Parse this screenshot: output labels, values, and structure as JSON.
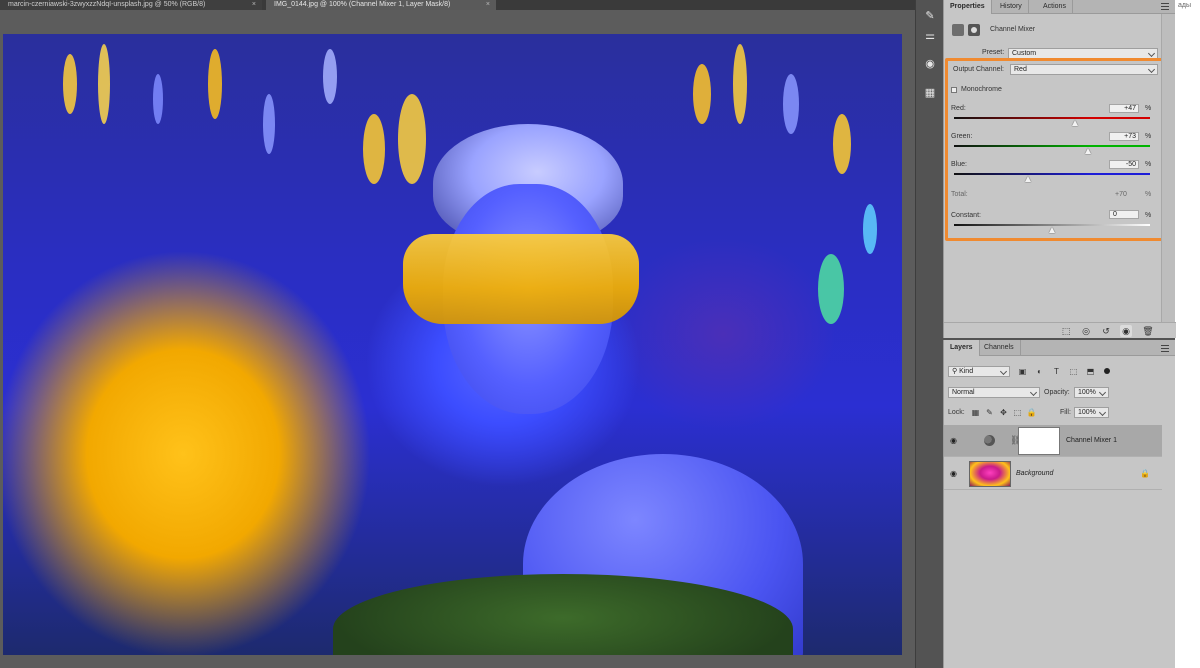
{
  "document_tabs": [
    {
      "label": "marcin-czerniawski-3zwyxzzNdqI-unsplash.jpg @ 50% (RGB/8)",
      "close": "×"
    },
    {
      "label": "IMG_0144.jpg @ 100% (Channel Mixer 1, Layer Mask/8)",
      "close": "×"
    }
  ],
  "toolstrip": {
    "icons": [
      "brush-settings-icon",
      "adjust-sliders-icon",
      "color-palette-icon",
      "grid-table-icon"
    ],
    "glyphs": [
      "✎",
      "⚌",
      "◉",
      "▦"
    ]
  },
  "properties": {
    "tabs": [
      "Properties",
      "History",
      "Actions"
    ],
    "adjustment_title": "Channel Mixer",
    "preset_label": "Preset:",
    "preset_value": "Custom",
    "output_channel_label": "Output Channel:",
    "output_channel_value": "Red",
    "monochrome_label": "Monochrome",
    "monochrome_checked": false,
    "sliders": [
      {
        "label": "Red:",
        "value": "+47",
        "unit": "%",
        "amount": 47,
        "color": "#d40000"
      },
      {
        "label": "Green:",
        "value": "+73",
        "unit": "%",
        "amount": 73,
        "color": "#00b400"
      },
      {
        "label": "Blue:",
        "value": "-50",
        "unit": "%",
        "amount": -50,
        "color": "#1d1dd8"
      }
    ],
    "total_label": "Total:",
    "total_value": "+70",
    "total_unit": "%",
    "constant_label": "Constant:",
    "constant_value": "0",
    "constant_unit": "%",
    "constant_amount": 0,
    "highlight_color": "#f08a30",
    "footer_icons": [
      "clip-to-layer-icon",
      "view-previous-state-icon",
      "reset-icon",
      "visibility-icon",
      "delete-icon"
    ],
    "footer_glyphs": [
      "⬚",
      "◎",
      "↺",
      "◉",
      "🗑"
    ]
  },
  "layers": {
    "tabs": [
      "Layers",
      "Channels"
    ],
    "kind_label": "Kind",
    "filter_glyphs": [
      "▣",
      "◐",
      "T",
      "⬚",
      "⬒"
    ],
    "blend_mode": "Normal",
    "opacity_label": "Opacity:",
    "opacity_value": "100%",
    "lock_label": "Lock:",
    "fill_label": "Fill:",
    "fill_value": "100%",
    "lock_glyphs": [
      "▦",
      "✎",
      "✥",
      "⬚",
      "🔒"
    ],
    "items": [
      {
        "name": "Channel Mixer 1",
        "selected": true
      },
      {
        "name": "Background",
        "selected": false
      }
    ]
  },
  "side_text": "ады"
}
